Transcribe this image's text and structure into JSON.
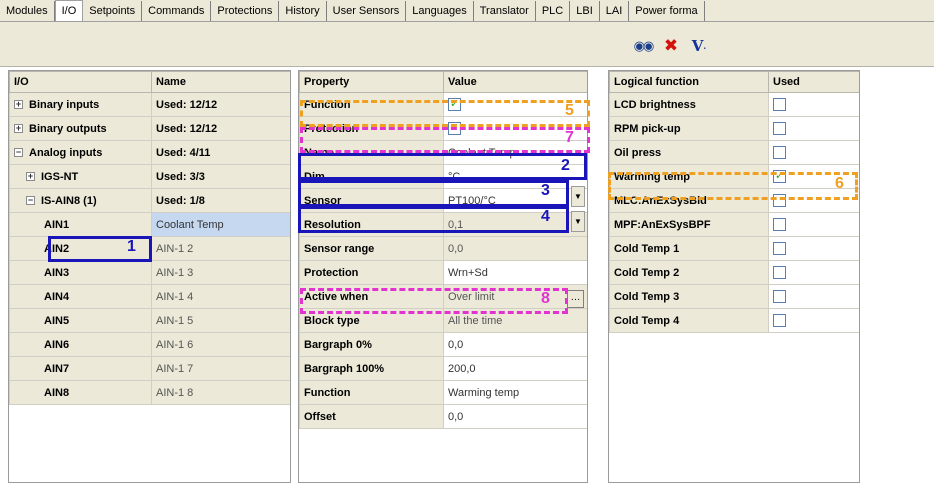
{
  "tabs": [
    {
      "label": "Modules"
    },
    {
      "label": "I/O",
      "active": true
    },
    {
      "label": "Setpoints"
    },
    {
      "label": "Commands"
    },
    {
      "label": "Protections"
    },
    {
      "label": "History"
    },
    {
      "label": "User Sensors"
    },
    {
      "label": "Languages"
    },
    {
      "label": "Translator"
    },
    {
      "label": "PLC"
    },
    {
      "label": "LBI"
    },
    {
      "label": "LAI"
    },
    {
      "label": "Power forma"
    }
  ],
  "toolbar": {
    "icons": [
      "find-icon",
      "delete-icon",
      "filter-icon"
    ]
  },
  "io_panel": {
    "headers": [
      "I/O",
      "Name"
    ],
    "rows": [
      {
        "label": "Binary inputs",
        "value": "Used: 12/12",
        "expander": "+"
      },
      {
        "label": "Binary outputs",
        "value": "Used: 12/12",
        "expander": "+"
      },
      {
        "label": "Analog inputs",
        "value": "Used: 4/11",
        "expander": "−"
      },
      {
        "label": "IGS-NT",
        "value": "Used: 3/3",
        "expander": "+"
      },
      {
        "label": "IS-AIN8 (1)",
        "value": "Used: 1/8",
        "expander": "−"
      },
      {
        "label": "AIN1",
        "value": "Coolant Temp"
      },
      {
        "label": "AIN2",
        "value": "AIN-1 2"
      },
      {
        "label": "AIN3",
        "value": "AIN-1 3"
      },
      {
        "label": "AIN4",
        "value": "AIN-1 4"
      },
      {
        "label": "AIN5",
        "value": "AIN-1 5"
      },
      {
        "label": "AIN6",
        "value": "AIN-1 6"
      },
      {
        "label": "AIN7",
        "value": "AIN-1 7"
      },
      {
        "label": "AIN8",
        "value": "AIN-1 8"
      }
    ]
  },
  "props_panel": {
    "headers": [
      "Property",
      "Value"
    ],
    "rows": [
      {
        "label": "Function",
        "value": "",
        "checkbox": true
      },
      {
        "label": "Protection",
        "value": "",
        "checkbox": true
      },
      {
        "label": "Name",
        "value": "Coolant Temp"
      },
      {
        "label": "Dim",
        "value": "°C"
      },
      {
        "label": "Sensor",
        "value": "PT100/°C"
      },
      {
        "label": "Resolution",
        "value": "0,1"
      },
      {
        "label": "Sensor range",
        "value": "0,0"
      },
      {
        "label": "Protection",
        "value": "Wrn+Sd"
      },
      {
        "label": "Active when",
        "value": "Over limit"
      },
      {
        "label": "Block type",
        "value": "All the time"
      },
      {
        "label": "Bargraph 0%",
        "value": "0,0"
      },
      {
        "label": "Bargraph 100%",
        "value": "200,0"
      },
      {
        "label": "Function",
        "value": "Warming temp"
      },
      {
        "label": "Offset",
        "value": "0,0"
      }
    ]
  },
  "logic_panel": {
    "headers": [
      "Logical function",
      "Used"
    ],
    "rows": [
      {
        "label": "LCD brightness",
        "checked": false
      },
      {
        "label": "RPM pick-up",
        "checked": false
      },
      {
        "label": "Oil press",
        "checked": false
      },
      {
        "label": "Warming temp",
        "checked": true
      },
      {
        "label": "MLC:AnExSysBld",
        "checked": false
      },
      {
        "label": "MPF:AnExSysBPF",
        "checked": false
      },
      {
        "label": "Cold Temp 1",
        "checked": false
      },
      {
        "label": "Cold Temp 2",
        "checked": false
      },
      {
        "label": "Cold Temp 3",
        "checked": false
      },
      {
        "label": "Cold Temp 4",
        "checked": false
      }
    ]
  },
  "callouts": [
    "1",
    "2",
    "3",
    "4",
    "5",
    "6",
    "7",
    "8"
  ],
  "colors": {
    "blue_highlight": "#1a15b8",
    "orange_highlight": "#f0a020",
    "pink_highlight": "#e233d0"
  }
}
